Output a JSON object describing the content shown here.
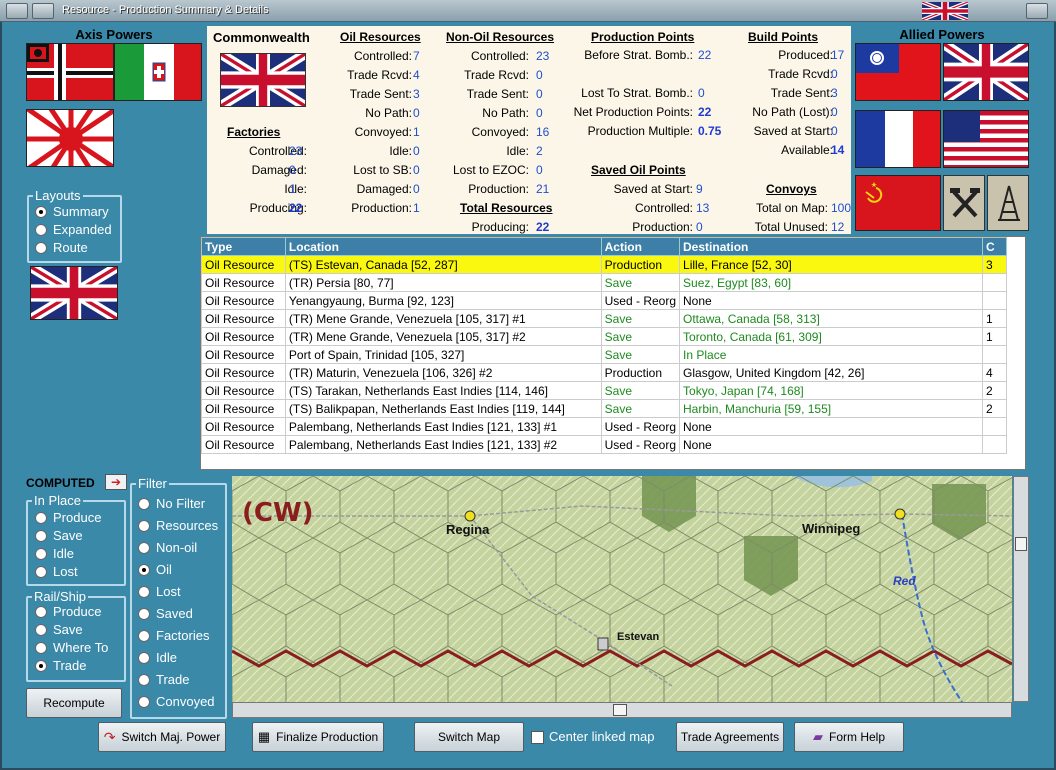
{
  "window": {
    "title": "Resource - Production Summary & Details"
  },
  "axis": {
    "header": "Axis Powers"
  },
  "allied": {
    "header": "Allied Powers"
  },
  "country": {
    "name": "Commonwealth"
  },
  "layouts": {
    "title": "Layouts",
    "options": [
      "Summary",
      "Expanded",
      "Route"
    ],
    "selected": 0
  },
  "factories": {
    "title": "Factories",
    "labels": [
      "Controlled:",
      "Damaged:",
      "Idle:",
      "Producing:"
    ],
    "values": [
      "23",
      "0",
      "1",
      "22"
    ]
  },
  "oil": {
    "title": "Oil Resources",
    "labels": [
      "Controlled:",
      "Trade Rcvd:",
      "Trade Sent:",
      "No Path:",
      "Convoyed:",
      "Idle:",
      "Lost to SB:",
      "Damaged:",
      "Production:"
    ],
    "values": [
      "7",
      "4",
      "3",
      "0",
      "1",
      "0",
      "0",
      "0",
      "1"
    ]
  },
  "nonoil": {
    "title": "Non-Oil Resources",
    "labels": [
      "Controlled:",
      "Trade Rcvd:",
      "Trade Sent:",
      "No Path:",
      "Convoyed:",
      "Idle:",
      "Lost to EZOC:",
      "Production:"
    ],
    "values": [
      "23",
      "0",
      "0",
      "0",
      "16",
      "2",
      "0",
      "21"
    ]
  },
  "total": {
    "title": "Total Resources",
    "label": "Producing:",
    "value": "22"
  },
  "pp": {
    "title": "Production Points",
    "labels": [
      "Before Strat. Bomb.:",
      "Lost To Strat. Bomb.:",
      "Net Production Points:",
      "Production Multiple:"
    ],
    "values": [
      "22",
      "0",
      "22",
      "0.75"
    ]
  },
  "savedoil": {
    "title": "Saved Oil Points",
    "labels": [
      "Saved at Start:",
      "Controlled:",
      "Production:"
    ],
    "values": [
      "9",
      "13",
      "0"
    ]
  },
  "bp": {
    "title": "Build Points",
    "labels": [
      "Produced:",
      "Trade Rcvd:",
      "Trade Sent:",
      "No Path (Lost):",
      "Saved at Start:",
      "Available:"
    ],
    "values": [
      "17",
      "0",
      "3",
      "0",
      "0",
      "14"
    ]
  },
  "convoys": {
    "title": "Convoys",
    "labels": [
      "Total on Map:",
      "Total Unused:"
    ],
    "values": [
      "100",
      "12"
    ]
  },
  "table": {
    "headers": [
      "Type",
      "Location",
      "Action",
      "Destination",
      "C"
    ],
    "rows": [
      [
        "Oil Resource",
        "(TS) Estevan, Canada [52, 287]",
        "Production",
        "Lille, France [52, 30]",
        "3"
      ],
      [
        "Oil Resource",
        "(TR) Persia [80, 77]",
        "Save",
        "Suez, Egypt [83, 60]",
        ""
      ],
      [
        "Oil Resource",
        "Yenangyaung, Burma [92, 123]",
        "Used - Reorg",
        "None",
        ""
      ],
      [
        "Oil Resource",
        "(TR) Mene Grande, Venezuela [105, 317] #1",
        "Save",
        "Ottawa, Canada [58, 313]",
        "1"
      ],
      [
        "Oil Resource",
        "(TR) Mene Grande, Venezuela [105, 317] #2",
        "Save",
        "Toronto, Canada [61, 309]",
        "1"
      ],
      [
        "Oil Resource",
        "Port of Spain, Trinidad [105, 327]",
        "Save",
        "In Place",
        ""
      ],
      [
        "Oil Resource",
        "(TR) Maturin, Venezuela [106, 326] #2",
        "Production",
        "Glasgow, United Kingdom [42, 26]",
        "4"
      ],
      [
        "Oil Resource",
        "(TS) Tarakan, Netherlands East Indies [114, 146]",
        "Save",
        "Tokyo, Japan [74, 168]",
        "2"
      ],
      [
        "Oil Resource",
        "(TS) Balikpapan, Netherlands East Indies [119, 144]",
        "Save",
        "Harbin, Manchuria [59, 155]",
        "2"
      ],
      [
        "Oil Resource",
        "Palembang, Netherlands East Indies [121, 133] #1",
        "Used - Reorg",
        "None",
        ""
      ],
      [
        "Oil Resource",
        "Palembang, Netherlands East Indies [121, 133] #2",
        "Used - Reorg",
        "None",
        ""
      ]
    ],
    "selected_row": 0
  },
  "computed": {
    "label": "COMPUTED"
  },
  "inplace": {
    "title": "In Place",
    "options": [
      "Produce",
      "Save",
      "Idle",
      "Lost"
    ]
  },
  "railship": {
    "title": "Rail/Ship",
    "options": [
      "Produce",
      "Save",
      "Where To",
      "Trade"
    ],
    "selected": 3
  },
  "filter": {
    "title": "Filter",
    "options": [
      "No Filter",
      "Resources",
      "Non-oil",
      "Oil",
      "Lost",
      "Saved",
      "Factories",
      "Idle",
      "Trade",
      "Convoyed"
    ],
    "selected": 3
  },
  "map": {
    "region": "(CW)",
    "cities": [
      "Regina",
      "Winnipeg",
      "Estevan"
    ],
    "river": "Red"
  },
  "buttons": {
    "recompute": "Recompute",
    "switch_power": "Switch Maj. Power",
    "finalize": "Finalize Production",
    "switch_map": "Switch Map",
    "center_linked": "Center linked map",
    "trade": "Trade Agreements",
    "help": "Form Help"
  },
  "colors": {
    "panel_bg": "#3b89a9",
    "selected_row": "#fbf80f",
    "value_blue": "#1f4fcf",
    "save_green": "#1e8a1e"
  }
}
